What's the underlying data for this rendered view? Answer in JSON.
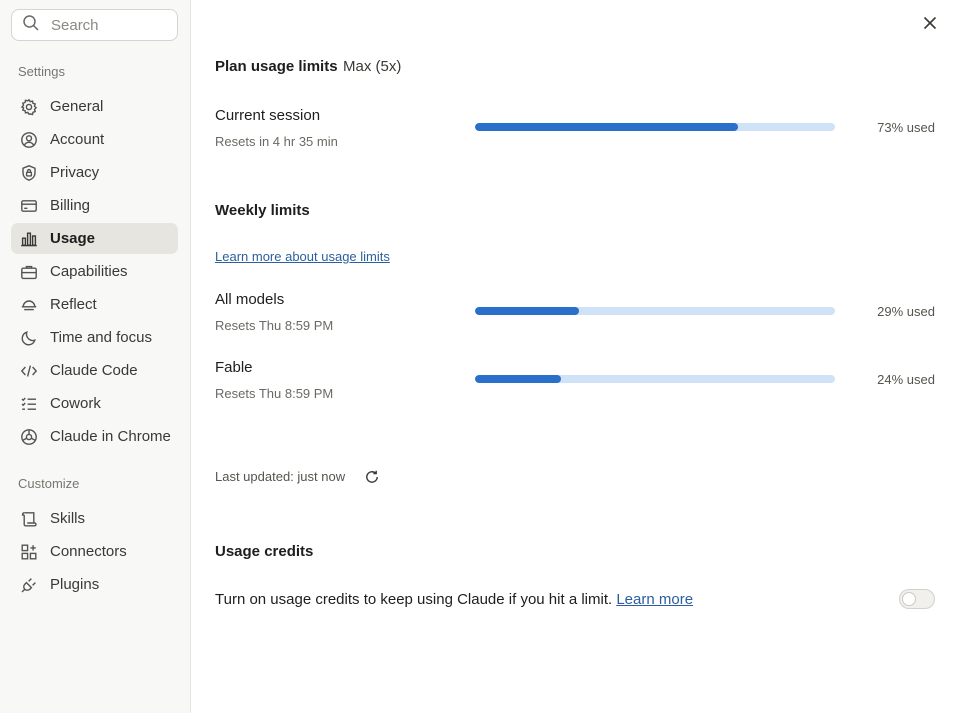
{
  "search": {
    "placeholder": "Search"
  },
  "sidebar": {
    "settings_label": "Settings",
    "customize_label": "Customize",
    "items": [
      {
        "label": "General",
        "icon": "gear-icon"
      },
      {
        "label": "Account",
        "icon": "user-circle-icon"
      },
      {
        "label": "Privacy",
        "icon": "shield-lock-icon"
      },
      {
        "label": "Billing",
        "icon": "credit-card-icon"
      },
      {
        "label": "Usage",
        "icon": "bar-chart-icon",
        "active": true
      },
      {
        "label": "Capabilities",
        "icon": "briefcase-icon"
      },
      {
        "label": "Reflect",
        "icon": "reflect-icon"
      },
      {
        "label": "Time and focus",
        "icon": "moon-icon"
      },
      {
        "label": "Claude Code",
        "icon": "code-icon"
      },
      {
        "label": "Cowork",
        "icon": "checklist-icon"
      },
      {
        "label": "Claude in Chrome",
        "icon": "globe-icon"
      }
    ],
    "customize_items": [
      {
        "label": "Skills",
        "icon": "scroll-icon"
      },
      {
        "label": "Connectors",
        "icon": "grid-plus-icon"
      },
      {
        "label": "Plugins",
        "icon": "plug-icon"
      }
    ]
  },
  "plan": {
    "title": "Plan usage limits",
    "tier": "Max (5x)",
    "current_session": {
      "label": "Current session",
      "reset": "Resets in 4 hr 35 min",
      "percent": 73,
      "percent_label": "73% used"
    }
  },
  "weekly": {
    "title": "Weekly limits",
    "learn_more": "Learn more about usage limits",
    "rows": [
      {
        "label": "All models",
        "reset": "Resets Thu 8:59 PM",
        "percent": 29,
        "percent_label": "29% used"
      },
      {
        "label": "Fable",
        "reset": "Resets Thu 8:59 PM",
        "percent": 24,
        "percent_label": "24% used"
      }
    ]
  },
  "last_updated": "Last updated: just now",
  "credits": {
    "title": "Usage credits",
    "description": "Turn on usage credits to keep using Claude if you hit a limit.",
    "learn_more": "Learn more",
    "enabled": false
  },
  "colors": {
    "bar_fill": "#2a6fc9",
    "bar_track": "#cfe2f7",
    "link": "#2c5f9e",
    "active_nav_bg": "#e6e5e0"
  }
}
